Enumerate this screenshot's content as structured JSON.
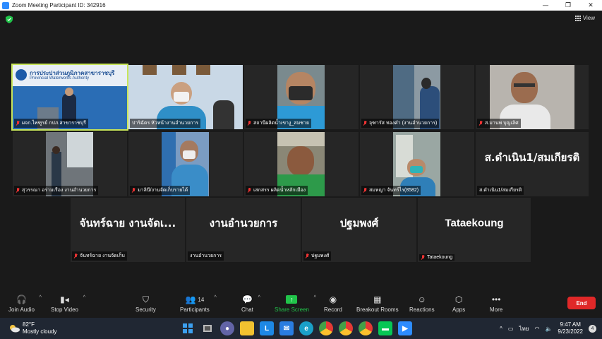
{
  "window": {
    "title": "Zoom Meeting Participant ID: 342916",
    "minimize": "—",
    "restore": "❐",
    "close": "✕"
  },
  "meeting": {
    "view_label": "View"
  },
  "tiles": [
    {
      "name": "ผจก.ไพฑูรย์ กปภ.สาขาราชบุรี",
      "muted": true,
      "bg": "#2a6db5",
      "screen_text_1": "การประปาส่วนภูมิภาคสาขาราชบุรี",
      "screen_text_2": "Provincial Waterworks Authority"
    },
    {
      "name": "ปาริฉัตร หัวหน้างานอำนวยการ",
      "muted": false,
      "bg": "#c9d8e6"
    },
    {
      "name": "สถานีผลิตน้ำเขางู_สมชาย",
      "muted": true,
      "bg": "#7a8a8e"
    },
    {
      "name": "จุฑารัส ทองคำ (งานอำนวยการ)",
      "muted": true,
      "bg": "#8c9aa3"
    },
    {
      "name": "ส.มานพ บุญเลิศ",
      "muted": true,
      "bg": "#b8b4ae"
    },
    {
      "name": "สุวรรณา อร่ามเรือง งานอำนวยการ",
      "muted": true,
      "bg": "#6f757a"
    },
    {
      "name": "มาลินี/งานจัดเก็บรายได้",
      "muted": true,
      "bg": "#7b9cc2"
    },
    {
      "name": "เสกสรร ผลิตน้ำหลักเมือง",
      "muted": true,
      "bg": "#8a8776"
    },
    {
      "name": "สมหญา จันทร์ไร(8582)",
      "muted": true,
      "bg": "#9aa7a3"
    },
    {
      "name": "ส.ดำเนิน1/สมเกียรติ",
      "muted": false,
      "big": "ส.ดำเนิน1/สมเกียรติ"
    },
    {
      "name": "จันทร์ฉาย งานจัดเก็บ",
      "muted": true,
      "big": "จันทร์ฉาย งานจัดเ..."
    },
    {
      "name": "งานอำนวยการ",
      "muted": false,
      "big": "งานอำนวยการ"
    },
    {
      "name": "ปฐมพงศ์",
      "muted": true,
      "big": "ปฐมพงศ์"
    },
    {
      "name": "Tataekoung",
      "muted": true,
      "big": "Tataekoung"
    }
  ],
  "toolbar": {
    "join_audio": "Join Audio",
    "stop_video": "Stop Video",
    "security": "Security",
    "participants": "Participants",
    "participants_count": "14",
    "chat": "Chat",
    "share_screen": "Share Screen",
    "record": "Record",
    "breakout_rooms": "Breakout Rooms",
    "reactions": "Reactions",
    "apps": "Apps",
    "more": "More",
    "end": "End"
  },
  "taskbar": {
    "temperature": "82°F",
    "weather": "Mostly cloudy",
    "language": "ไทย",
    "time": "9:47 AM",
    "date": "9/23/2022",
    "notifications": "4"
  }
}
